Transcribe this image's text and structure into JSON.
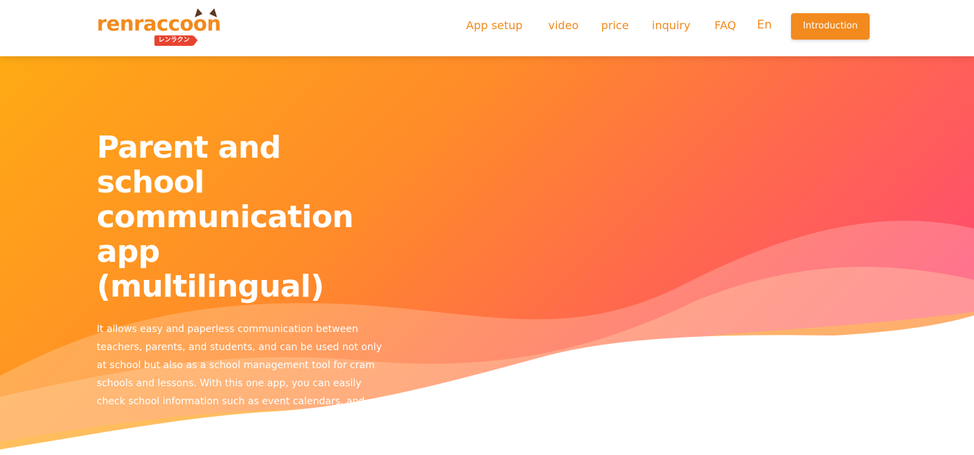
{
  "header": {
    "logo": {
      "text": "renraccoon",
      "badge": "レンラクン"
    },
    "nav": [
      {
        "label": "App setup"
      },
      {
        "label": "video"
      },
      {
        "label": "price"
      },
      {
        "label": "inquiry"
      },
      {
        "label": "FAQ"
      },
      {
        "label": "En"
      }
    ],
    "cta_label": "Introduction"
  },
  "hero": {
    "title": "Parent and school communication app (multilingual)",
    "description": "It allows easy and paperless communication between teachers, parents, and students, and can be used not only at school but also as a school management tool for cram schools and lessons. With this one app, you can easily check school information such as event calendars, and"
  },
  "colors": {
    "brand": "#f28a1e",
    "badge_red": "#e8432f",
    "gradient_start": "#ffaa14",
    "gradient_end": "#ff3d7f"
  }
}
